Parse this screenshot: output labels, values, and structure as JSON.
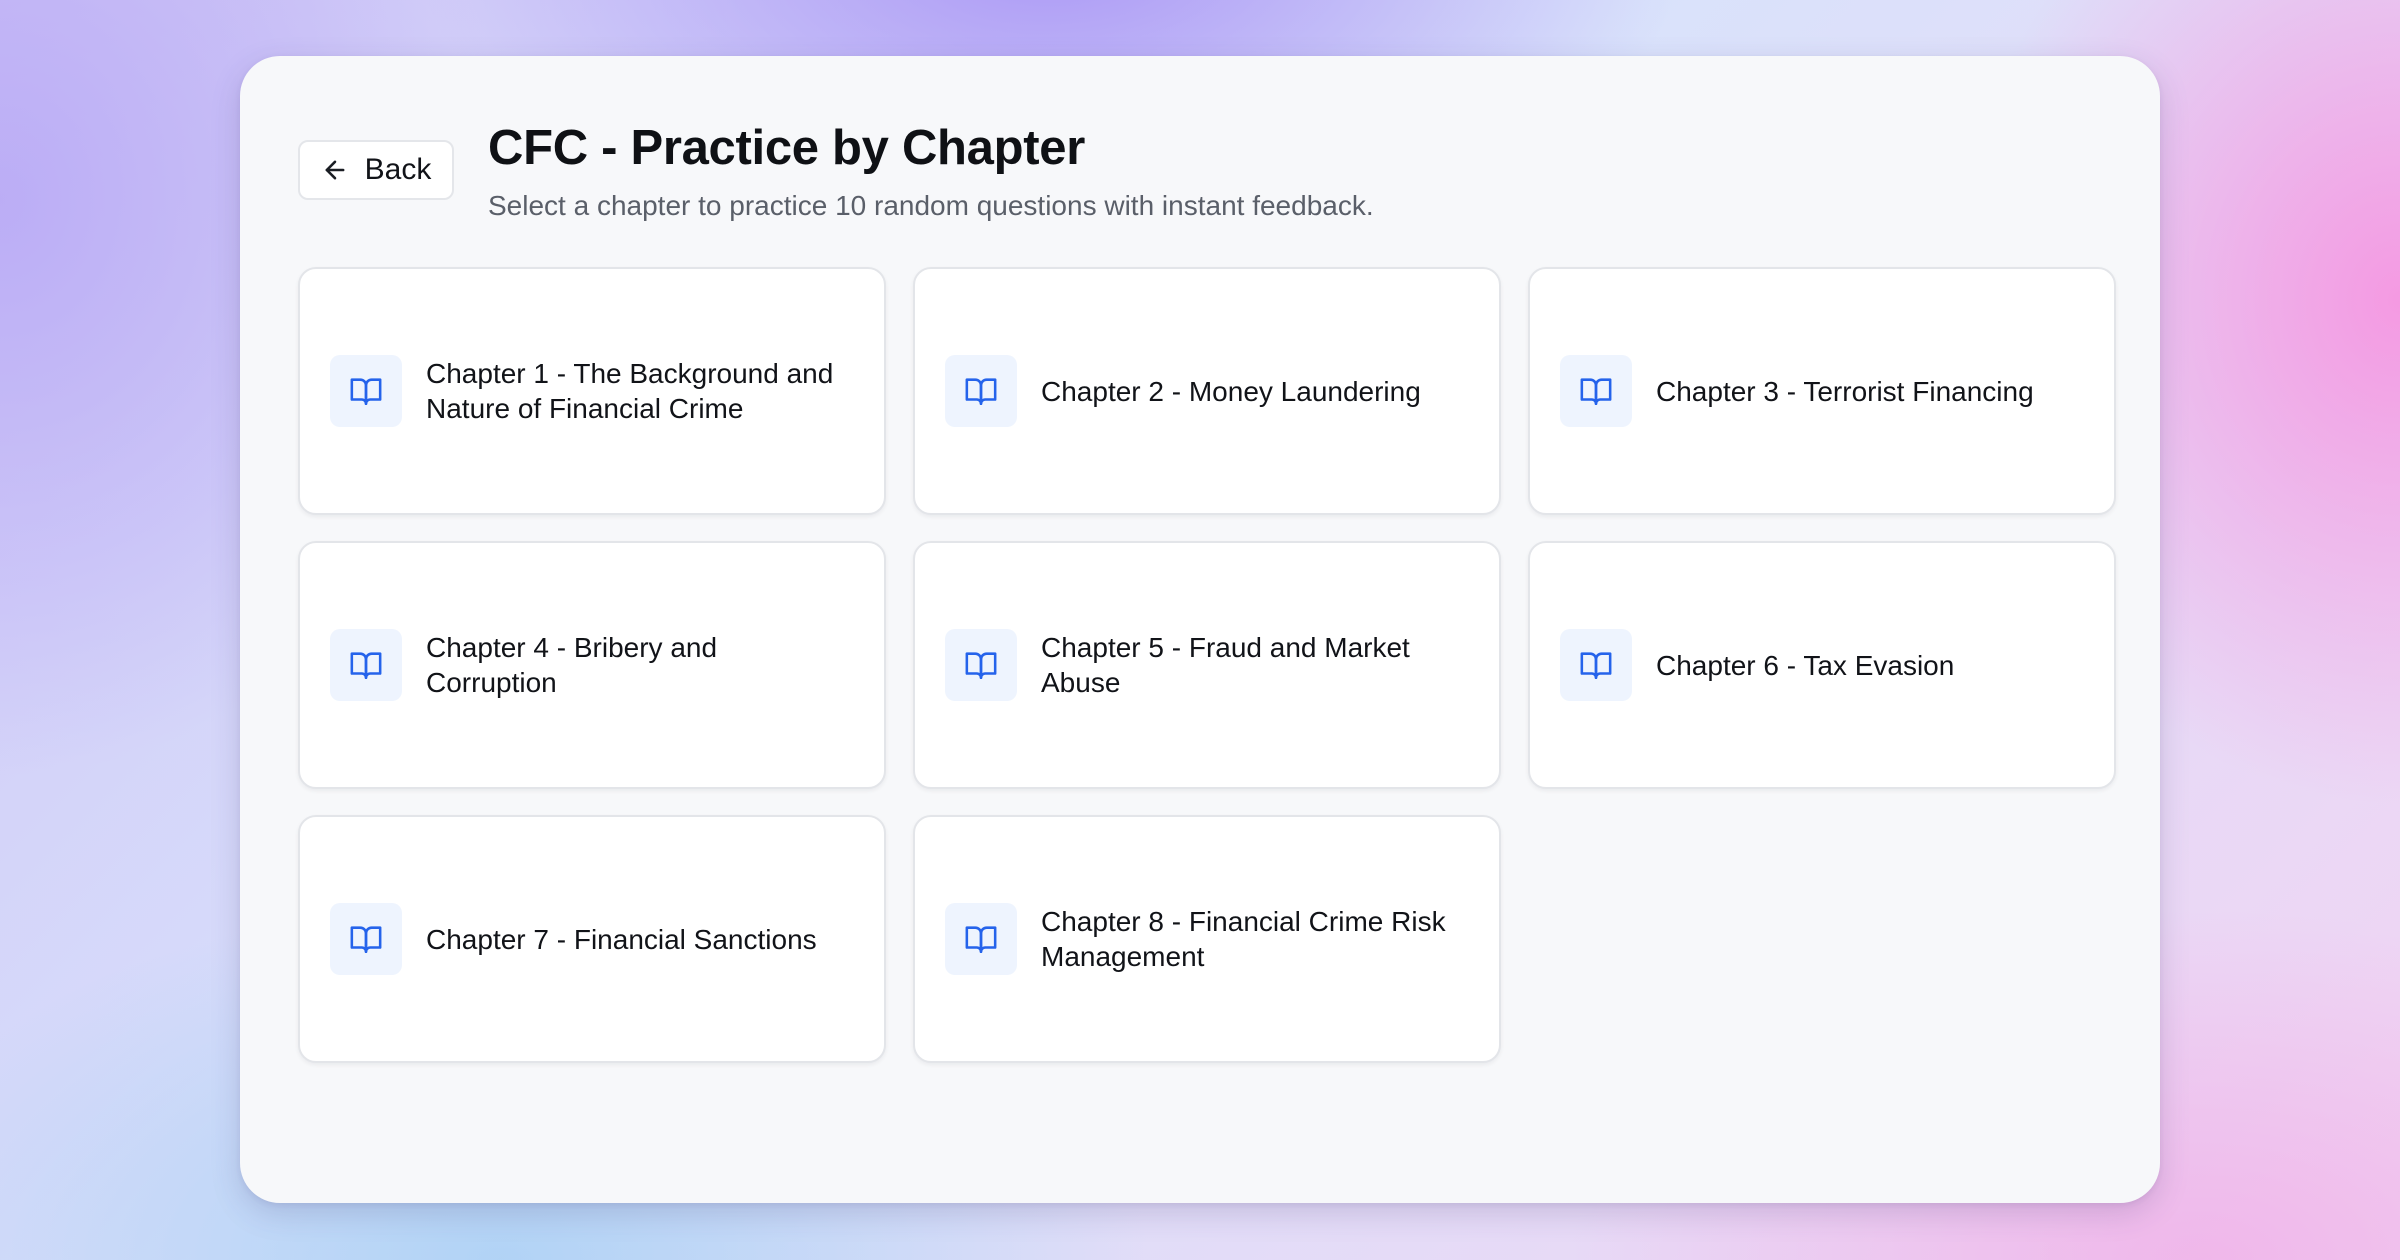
{
  "header": {
    "back_label": "Back",
    "title": "CFC - Practice by Chapter",
    "subtitle": "Select a chapter to practice 10 random questions with instant feedback."
  },
  "chapters": [
    {
      "label": "Chapter 1 - The Background and Nature of Financial Crime",
      "icon": "book-open-icon"
    },
    {
      "label": "Chapter 2 - Money Laundering",
      "icon": "book-open-icon"
    },
    {
      "label": "Chapter 3 - Terrorist Financing",
      "icon": "book-open-icon"
    },
    {
      "label": "Chapter 4 - Bribery and Corruption",
      "icon": "book-open-icon"
    },
    {
      "label": "Chapter 5 - Fraud and Market Abuse",
      "icon": "book-open-icon"
    },
    {
      "label": "Chapter 6 - Tax Evasion",
      "icon": "book-open-icon"
    },
    {
      "label": "Chapter 7 - Financial Sanctions",
      "icon": "book-open-icon"
    },
    {
      "label": "Chapter 8 - Financial Crime Risk Management",
      "icon": "book-open-icon"
    }
  ],
  "colors": {
    "accent": "#2563eb",
    "icon_bg": "#eef4fe",
    "card_bg": "#ffffff",
    "panel_bg": "#f7f8fa"
  }
}
